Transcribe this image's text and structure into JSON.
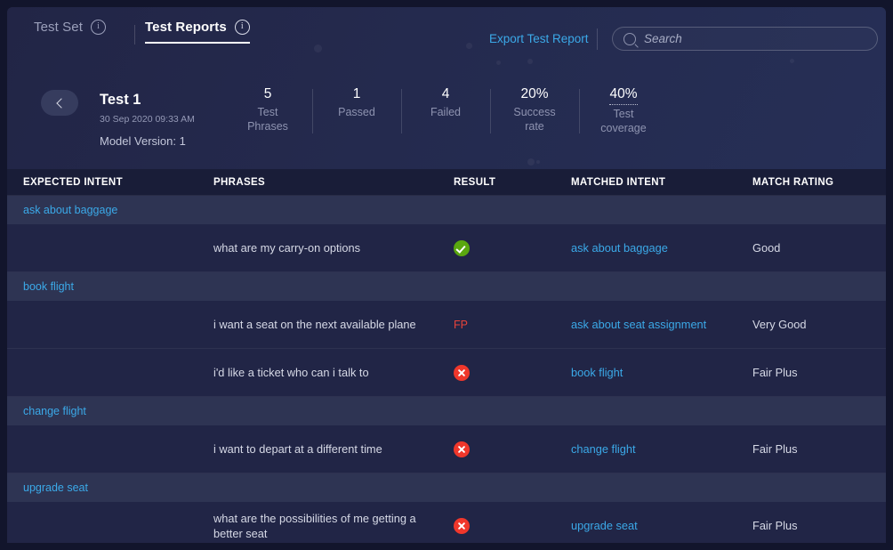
{
  "tabs": [
    {
      "label": "Test Set",
      "active": false,
      "info_icon": "info-icon"
    },
    {
      "label": "Test Reports",
      "active": true,
      "info_icon": "info-icon"
    }
  ],
  "toolbar": {
    "export_label": "Export Test Report",
    "search_placeholder": "Search",
    "search_value": "",
    "search_icon": "search-icon"
  },
  "header": {
    "back_icon": "chevron-left-icon",
    "title": "Test 1",
    "date": "30 Sep 2020 09:33 AM",
    "model_version": "Model Version: 1",
    "stats": [
      {
        "value": "5",
        "label": "Test Phrases",
        "dotted": false
      },
      {
        "value": "1",
        "label": "Passed",
        "dotted": false
      },
      {
        "value": "4",
        "label": "Failed",
        "dotted": false
      },
      {
        "value": "20%",
        "label": "Success rate",
        "dotted": false
      },
      {
        "value": "40%",
        "label": "Test coverage",
        "dotted": true
      }
    ]
  },
  "table": {
    "columns": [
      "EXPECTED INTENT",
      "PHRASES",
      "RESULT",
      "MATCHED INTENT",
      "MATCH RATING"
    ],
    "groups": [
      {
        "intent": "ask about baggage",
        "rows": [
          {
            "phrase": "what are my carry-on options",
            "result_type": "pass",
            "result_text": "",
            "matched_intent": "ask about baggage",
            "match_rating": "Good"
          }
        ]
      },
      {
        "intent": "book flight",
        "rows": [
          {
            "phrase": "i want a seat on the next available plane",
            "result_type": "fp",
            "result_text": "FP",
            "matched_intent": "ask about seat assignment",
            "match_rating": "Very Good"
          },
          {
            "phrase": "i'd like a ticket who can i talk to",
            "result_type": "fail",
            "result_text": "",
            "matched_intent": "book flight",
            "match_rating": "Fair Plus"
          }
        ]
      },
      {
        "intent": "change flight",
        "rows": [
          {
            "phrase": "i want to depart at a different time",
            "result_type": "fail",
            "result_text": "",
            "matched_intent": "change flight",
            "match_rating": "Fair Plus"
          }
        ]
      },
      {
        "intent": "upgrade seat",
        "rows": [
          {
            "phrase": "what are the possibilities of me getting a better seat",
            "result_type": "fail",
            "result_text": "",
            "matched_intent": "upgrade seat",
            "match_rating": "Fair Plus"
          }
        ]
      }
    ]
  },
  "colors": {
    "accent_link": "#3ba9e8",
    "pass_green": "#5aa70f",
    "fail_red": "#f0372b",
    "fp_red": "#e8433a",
    "panel_bg": "#242a4e",
    "row_bg": "#212546",
    "group_bg": "#2e3453"
  }
}
